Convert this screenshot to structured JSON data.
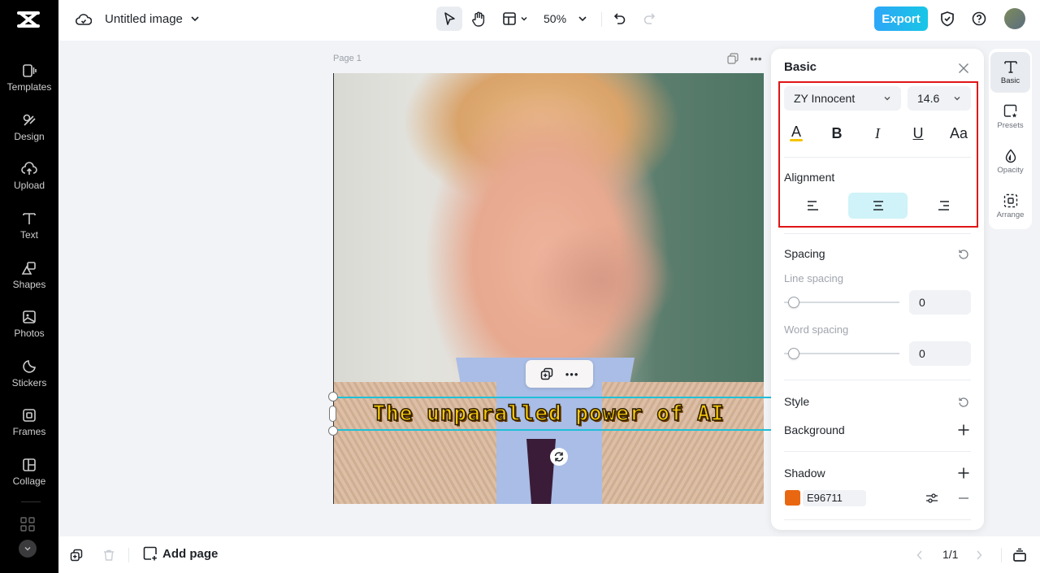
{
  "app": {
    "title": "Untitled image"
  },
  "sidebar": {
    "items": [
      {
        "label": "Templates",
        "icon": "templates-icon"
      },
      {
        "label": "Design",
        "icon": "design-icon"
      },
      {
        "label": "Upload",
        "icon": "upload-icon"
      },
      {
        "label": "Text",
        "icon": "text-icon"
      },
      {
        "label": "Shapes",
        "icon": "shapes-icon"
      },
      {
        "label": "Photos",
        "icon": "photos-icon"
      },
      {
        "label": "Stickers",
        "icon": "stickers-icon"
      },
      {
        "label": "Frames",
        "icon": "frames-icon"
      },
      {
        "label": "Collage",
        "icon": "collage-icon"
      }
    ],
    "apps_label": "Apps"
  },
  "toolbar": {
    "zoom": "50%",
    "export_label": "Export"
  },
  "canvas": {
    "page_label": "Page 1",
    "caption_text": "The unparalled power of AI",
    "caption_color": "#F7C80D"
  },
  "bottom": {
    "add_page_label": "Add page",
    "page_indicator": "1/1"
  },
  "panel": {
    "title": "Basic",
    "font_name": "ZY Innocent",
    "font_size": "14.6",
    "format_buttons": [
      "A",
      "B",
      "I",
      "U",
      "Aa"
    ],
    "text_color_underline": "#F5C400",
    "alignment_label": "Alignment",
    "alignment_selected": "center",
    "spacing_label": "Spacing",
    "line_spacing_label": "Line spacing",
    "line_spacing_value": "0",
    "word_spacing_label": "Word spacing",
    "word_spacing_value": "0",
    "style_label": "Style",
    "background_label": "Background",
    "shadow_label": "Shadow",
    "shadow_color_hex": "E96711",
    "shadow_color": "#E96711"
  },
  "right_tabs": [
    {
      "label": "Basic",
      "active": true
    },
    {
      "label": "Presets",
      "active": false
    },
    {
      "label": "Opacity",
      "active": false
    },
    {
      "label": "Arrange",
      "active": false
    }
  ],
  "colors": {
    "accent": "#1FC0D8",
    "export_gradient_start": "#2EA6F7",
    "export_gradient_end": "#17C6E6",
    "highlight_border": "#E01515"
  }
}
